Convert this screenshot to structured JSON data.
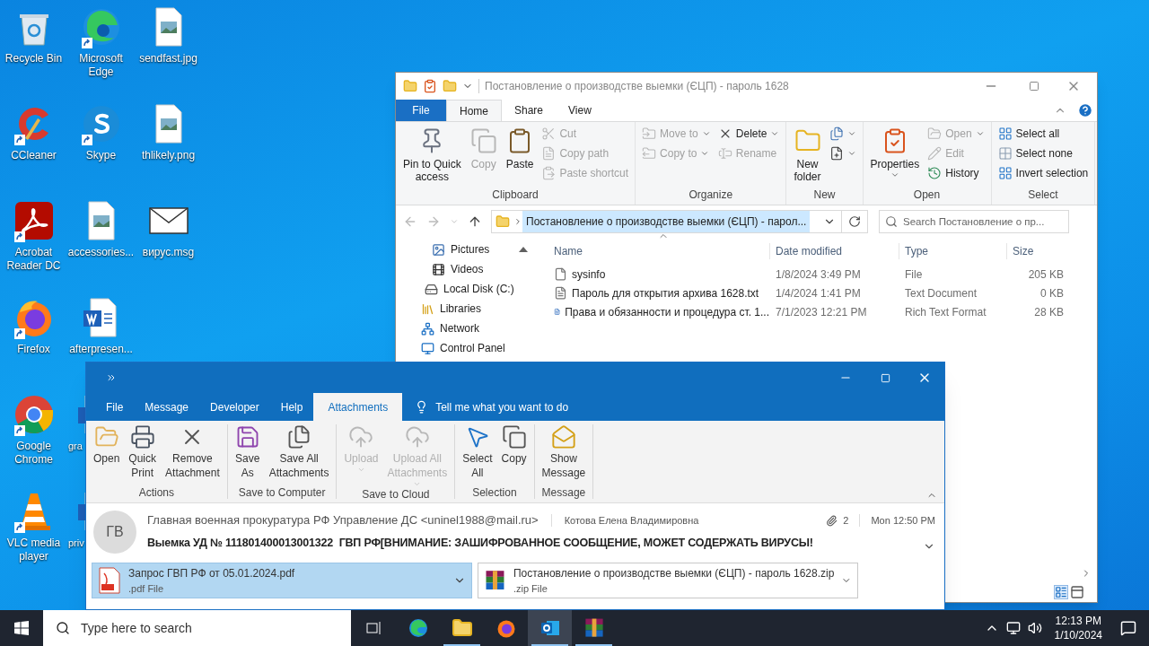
{
  "desktop_icons": [
    {
      "label": "Recycle Bin",
      "kind": "recycle",
      "shortcut": false
    },
    {
      "label": "CCleaner",
      "kind": "ccleaner",
      "shortcut": true
    },
    {
      "label": "Acrobat\nReader DC",
      "kind": "acrobat",
      "shortcut": true
    },
    {
      "label": "Firefox",
      "kind": "firefox",
      "shortcut": true
    },
    {
      "label": "Google\nChrome",
      "kind": "chrome",
      "shortcut": true
    },
    {
      "label": "VLC media\nplayer",
      "kind": "vlc",
      "shortcut": true
    },
    {
      "label": "Microsoft\nEdge",
      "kind": "edge",
      "shortcut": true
    },
    {
      "label": "Skype",
      "kind": "skype",
      "shortcut": true
    },
    {
      "label": "accessories...",
      "kind": "image",
      "shortcut": false
    },
    {
      "label": "afterpresen...",
      "kind": "word",
      "shortcut": false
    },
    {
      "label": "gra",
      "kind": "partial",
      "shortcut": false
    },
    {
      "label": "priv",
      "kind": "partial",
      "shortcut": false
    },
    {
      "label": "sendfast.jpg",
      "kind": "image",
      "shortcut": false
    },
    {
      "label": "thlikely.png",
      "kind": "image",
      "shortcut": false
    },
    {
      "label": "вирус.msg",
      "kind": "mail",
      "shortcut": false
    }
  ],
  "explorer": {
    "title": "Постановление о производстве выемки (ЄЦП) - пароль 1628",
    "tabs": [
      {
        "label": "File",
        "kind": "file",
        "selected": false
      },
      {
        "label": "Home",
        "kind": "tab",
        "selected": true
      },
      {
        "label": "Share",
        "kind": "tab",
        "selected": false
      },
      {
        "label": "View",
        "kind": "tab",
        "selected": false
      }
    ],
    "ribbon_groups": [
      {
        "label": "Clipboard",
        "columns": [
          [
            {
              "kind": "large",
              "label": "Pin to Quick\naccess",
              "disabled": false,
              "dropdown": false
            }
          ],
          [
            {
              "kind": "large",
              "label": "Copy",
              "disabled": true,
              "dropdown": false
            }
          ],
          [
            {
              "kind": "large",
              "label": "Paste",
              "disabled": false,
              "dropdown": false
            }
          ],
          [
            {
              "kind": "small",
              "label": "Cut",
              "disabled": true,
              "dropdown": false
            },
            {
              "kind": "small",
              "label": "Copy path",
              "disabled": true,
              "dropdown": false
            },
            {
              "kind": "small",
              "label": "Paste shortcut",
              "disabled": true,
              "dropdown": false
            }
          ]
        ]
      },
      {
        "label": "Organize",
        "columns": [
          [
            {
              "kind": "small",
              "label": "Move to",
              "disabled": true,
              "dropdown": true
            },
            {
              "kind": "small",
              "label": "Copy to",
              "disabled": true,
              "dropdown": true
            }
          ],
          [
            {
              "kind": "small",
              "label": "Delete",
              "disabled": false,
              "dropdown": true
            },
            {
              "kind": "small",
              "label": "Rename",
              "disabled": true,
              "dropdown": false
            }
          ]
        ]
      },
      {
        "label": "New",
        "columns": [
          [
            {
              "kind": "large",
              "label": "New\nfolder",
              "disabled": false,
              "dropdown": false
            }
          ],
          [
            {
              "kind": "small",
              "disabled": false,
              "dropdown": true
            },
            {
              "kind": "small",
              "disabled": false,
              "dropdown": true
            }
          ]
        ]
      },
      {
        "label": "Open",
        "columns": [
          [
            {
              "kind": "large",
              "label": "Properties",
              "disabled": false,
              "dropdown": true
            }
          ],
          [
            {
              "kind": "small",
              "label": "Open",
              "disabled": true,
              "dropdown": true
            },
            {
              "kind": "small",
              "label": "Edit",
              "disabled": true,
              "dropdown": false
            },
            {
              "kind": "small",
              "label": "History",
              "disabled": false,
              "dropdown": false
            }
          ]
        ]
      },
      {
        "label": "Select",
        "columns": [
          [
            {
              "kind": "small",
              "label": "Select all",
              "disabled": false,
              "dropdown": false
            },
            {
              "kind": "small",
              "label": "Select none",
              "disabled": false,
              "dropdown": false
            },
            {
              "kind": "small",
              "label": "Invert selection",
              "disabled": false,
              "dropdown": false
            }
          ]
        ]
      }
    ],
    "address": "Постановление о производстве выемки (ЄЦП) - парол...",
    "search_placeholder": "Search Постановление о пр...",
    "nav_items": [
      {
        "label": "Pictures",
        "kind": "pictures"
      },
      {
        "label": "Videos",
        "kind": "videos"
      },
      {
        "label": "Local Disk (C:)",
        "kind": "disk"
      },
      {
        "label": "Libraries",
        "kind": "libraries"
      },
      {
        "label": "Network",
        "kind": "network"
      },
      {
        "label": "Control Panel",
        "kind": "controlpanel"
      }
    ],
    "columns": [
      "Name",
      "Date modified",
      "Type",
      "Size"
    ],
    "files": [
      {
        "name": "sysinfo",
        "date": "1/8/2024 3:49 PM",
        "type": "File",
        "size": "205 KB",
        "kind": "file"
      },
      {
        "name": "Пароль для открытия архива 1628.txt",
        "date": "1/4/2024 1:41 PM",
        "type": "Text Document",
        "size": "0 KB",
        "kind": "text"
      },
      {
        "name": "Права и обязанности и процедура ст. 1...",
        "date": "7/1/2023 12:21 PM",
        "type": "Rich Text Format",
        "size": "28 KB",
        "kind": "rtf"
      }
    ]
  },
  "outlook": {
    "tabs": [
      {
        "label": "File",
        "selected": false
      },
      {
        "label": "Message",
        "selected": false
      },
      {
        "label": "Developer",
        "selected": false
      },
      {
        "label": "Help",
        "selected": false
      },
      {
        "label": "Attachments",
        "selected": true
      }
    ],
    "tell_me": "Tell me what you want to do",
    "ribbon_groups": [
      {
        "label": "Actions",
        "items": [
          {
            "label": "Open",
            "disabled": false,
            "dropdown": false
          },
          {
            "label": "Quick\nPrint",
            "disabled": false,
            "dropdown": false
          },
          {
            "label": "Remove\nAttachment",
            "disabled": false,
            "dropdown": false
          }
        ]
      },
      {
        "label": "Save to Computer",
        "items": [
          {
            "label": "Save\nAs",
            "disabled": false,
            "dropdown": false
          },
          {
            "label": "Save All\nAttachments",
            "disabled": false,
            "dropdown": false
          }
        ]
      },
      {
        "label": "Save to Cloud",
        "items": [
          {
            "label": "Upload",
            "disabled": true,
            "dropdown": true
          },
          {
            "label": "Upload All\nAttachments",
            "disabled": true,
            "dropdown": true
          }
        ]
      },
      {
        "label": "Selection",
        "items": [
          {
            "label": "Select\nAll",
            "disabled": false,
            "dropdown": false
          },
          {
            "label": "Copy",
            "disabled": false,
            "dropdown": false
          }
        ]
      },
      {
        "label": "Message",
        "items": [
          {
            "label": "Show\nMessage",
            "disabled": false,
            "dropdown": false
          }
        ]
      }
    ],
    "avatar": "ГВ",
    "from": "Главная военная прокуратура РФ Управление ДС <uninel1988@mail.ru>",
    "to": "Котова Елена Владимировна",
    "attachment_count": "2",
    "time": "Mon 12:50 PM",
    "subject": "Выемка УД № 111801400013001322  ГВП РФ[ВНИМАНИЕ: ЗАШИФРОВАННОЕ СООБЩЕНИЕ, МОЖЕТ СОДЕРЖАТЬ ВИРУСЫ!",
    "attachments": [
      {
        "name": "Запрос ГВП РФ от 05.01.2024.pdf",
        "type": ".pdf File",
        "kind": "pdf",
        "selected": true
      },
      {
        "name": "Постановление о производстве выемки (ЄЦП) - пароль 1628.zip",
        "type": ".zip File",
        "kind": "zip",
        "selected": false
      }
    ]
  },
  "taskbar": {
    "search_placeholder": "Type here to search",
    "apps": [
      {
        "kind": "edge",
        "running": false,
        "selected": false
      },
      {
        "kind": "explorer",
        "running": true,
        "selected": false
      },
      {
        "kind": "firefox",
        "running": false,
        "selected": false
      },
      {
        "kind": "outlook",
        "running": true,
        "selected": true
      },
      {
        "kind": "winrar",
        "running": true,
        "selected": false
      }
    ],
    "time": "12:13 PM",
    "date": "1/10/2024"
  }
}
